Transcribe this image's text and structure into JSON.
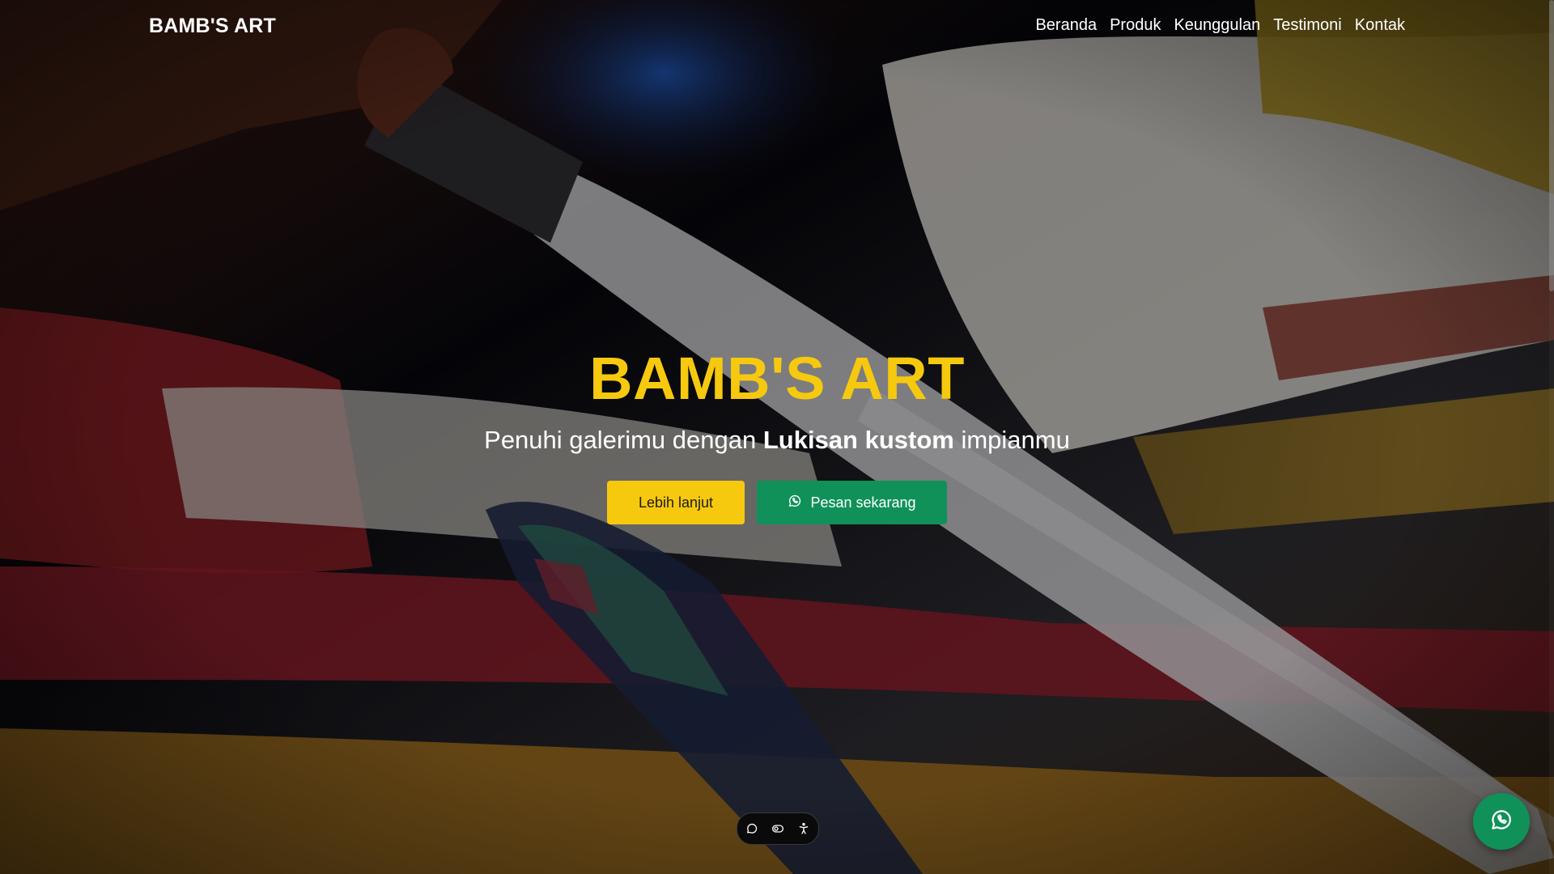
{
  "navbar": {
    "brand": "BAMB'S ART",
    "links": [
      {
        "label": "Beranda"
      },
      {
        "label": "Produk"
      },
      {
        "label": "Keunggulan"
      },
      {
        "label": "Testimoni"
      },
      {
        "label": "Kontak"
      }
    ]
  },
  "hero": {
    "title": "BAMB'S ART",
    "subtitle_prefix": "Penuhi galerimu dengan ",
    "subtitle_bold": "Lukisan kustom",
    "subtitle_suffix": " impianmu",
    "buttons": {
      "more_label": "Lebih lanjut",
      "order_label": "Pesan sekarang",
      "order_icon": "whatsapp-icon"
    },
    "background": "photo of paintbrushes on a painted canvas"
  },
  "toolbar": {
    "icons": [
      "chat-bubble-icon",
      "toggle-icon",
      "accessibility-icon"
    ]
  },
  "floating_button": {
    "icon": "whatsapp-icon"
  },
  "colors": {
    "accent_yellow": "#f6c90e",
    "accent_green": "#0f9159",
    "text_white": "#ffffff"
  }
}
